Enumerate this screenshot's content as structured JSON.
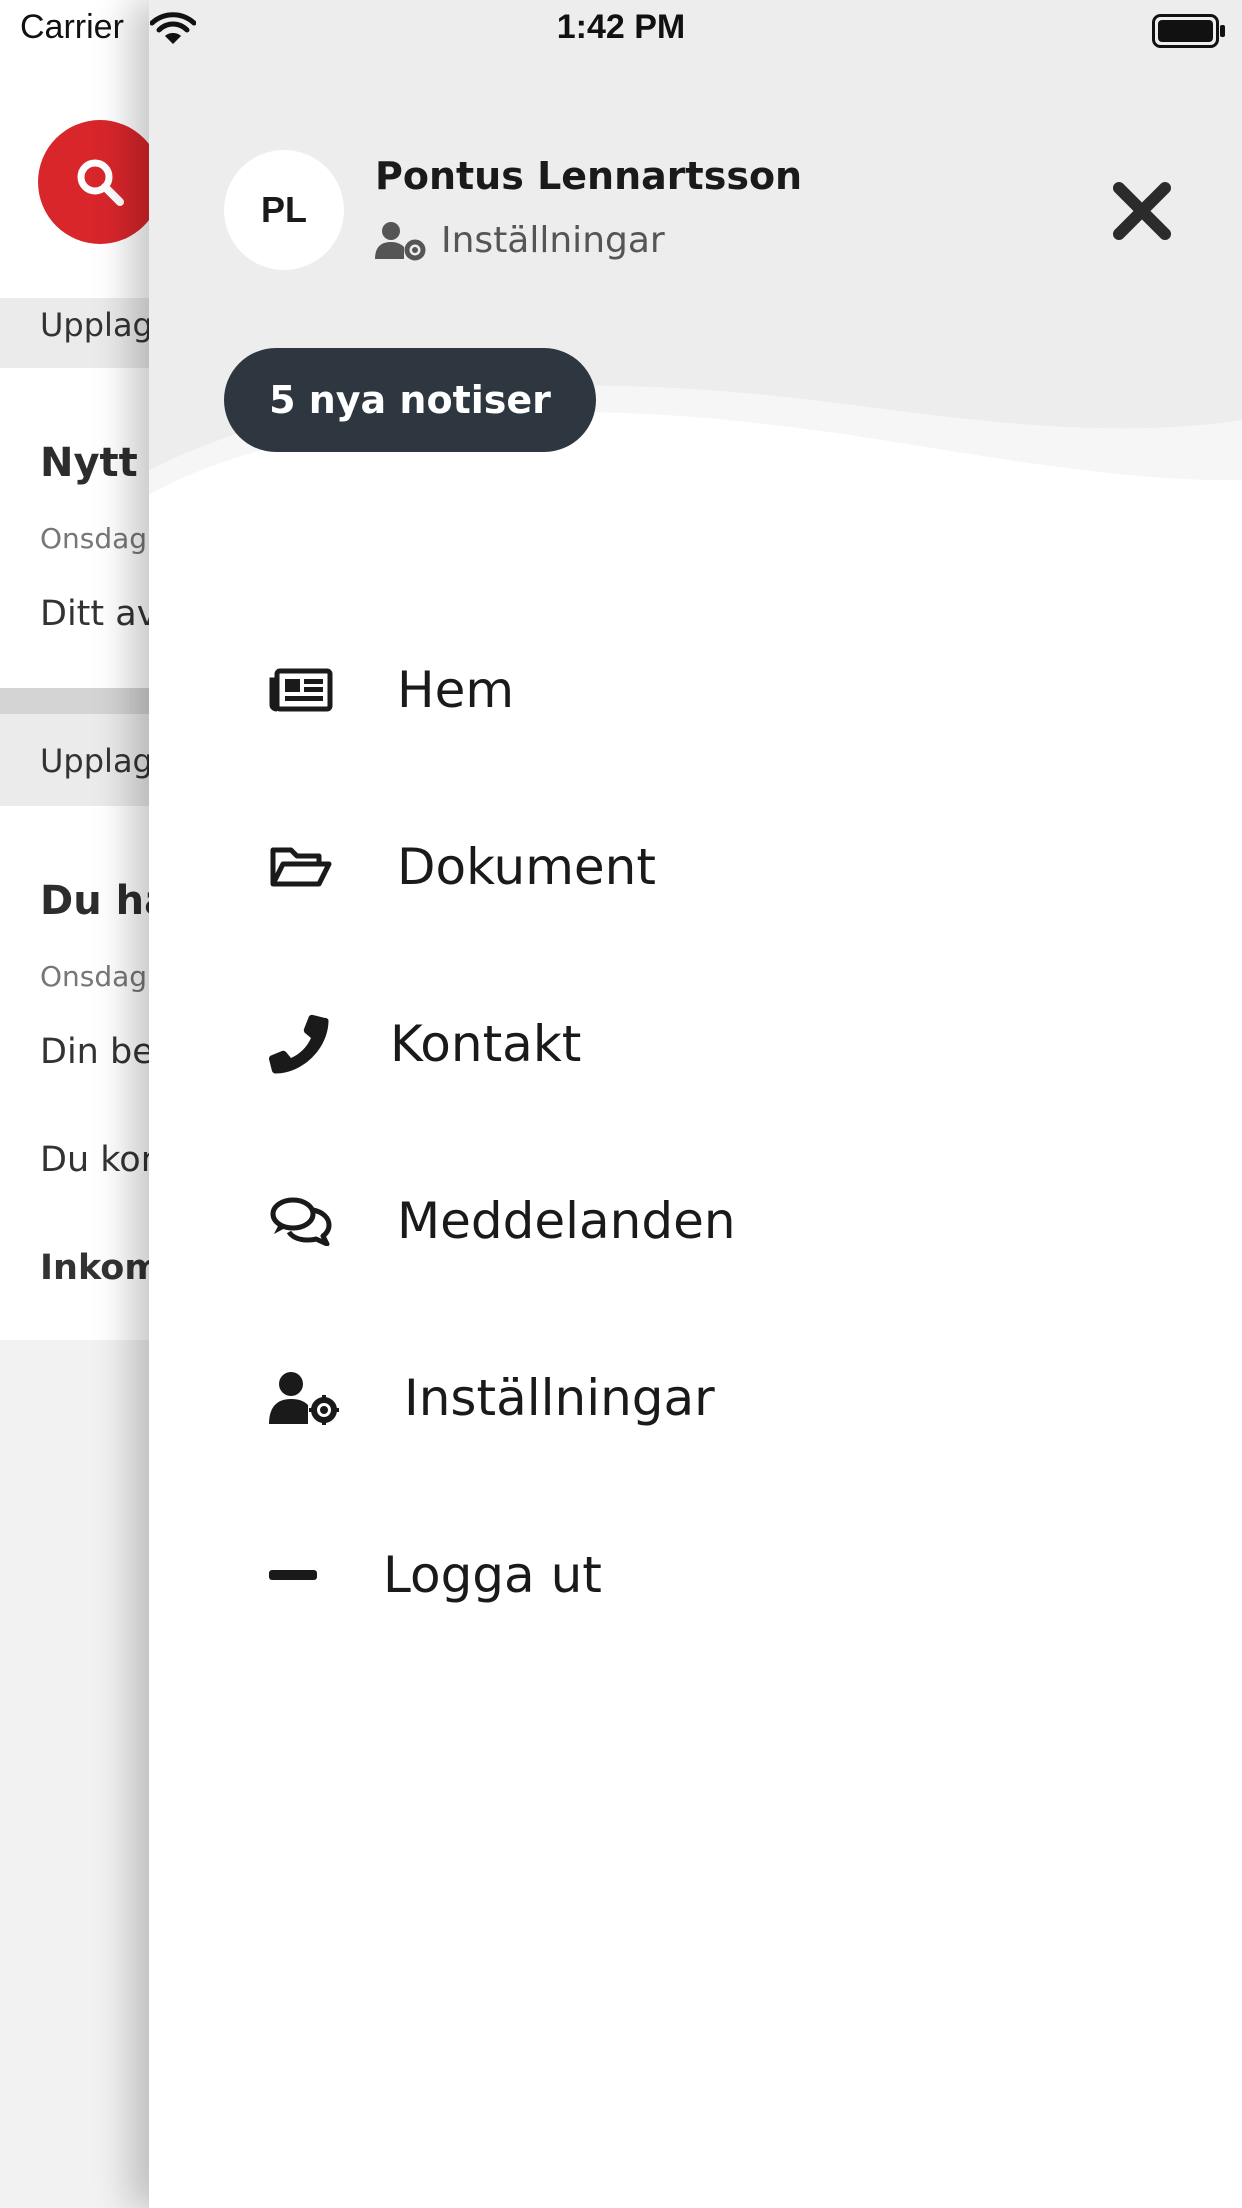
{
  "status_bar": {
    "carrier": "Carrier",
    "time": "1:42 PM"
  },
  "background": {
    "strip1": "Upplag",
    "card1": {
      "title": "Nytt",
      "date": "Onsdag",
      "body": "Ditt av"
    },
    "strip2": "Upplag",
    "card2": {
      "title": "Du ha",
      "date": "Onsdag",
      "body1": "Din be",
      "body2": "Du kon",
      "body3": "Inkom"
    }
  },
  "drawer": {
    "avatar_initials": "PL",
    "user_name": "Pontus Lennartsson",
    "settings_link": "Inställningar",
    "notifications": "5 nya notiser",
    "menu": [
      {
        "label": "Hem",
        "icon": "newspaper-icon"
      },
      {
        "label": "Dokument",
        "icon": "folder-open-icon"
      },
      {
        "label": "Kontakt",
        "icon": "phone-icon"
      },
      {
        "label": "Meddelanden",
        "icon": "comments-icon"
      },
      {
        "label": "Inställningar",
        "icon": "user-cog-icon"
      },
      {
        "label": "Logga ut",
        "icon": "minus-icon"
      }
    ]
  },
  "colors": {
    "accent_red": "#d8262b",
    "pill_dark": "#2e3740",
    "header_gray": "#ebebeb"
  }
}
